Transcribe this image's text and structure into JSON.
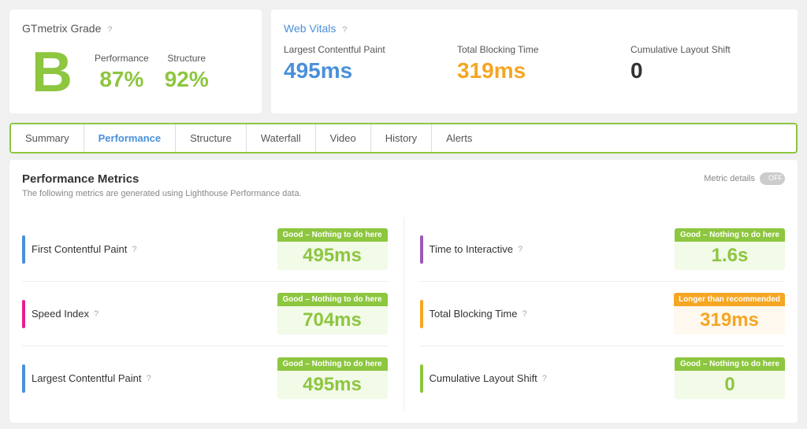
{
  "header": {
    "grade_section": "GTmetrix Grade",
    "grade_letter": "B",
    "performance_label": "Performance",
    "performance_value": "87%",
    "structure_label": "Structure",
    "structure_value": "92%",
    "vitals_section": "Web Vitals",
    "lcp_label": "Largest Contentful Paint",
    "lcp_value": "495ms",
    "tbt_label": "Total Blocking Time",
    "tbt_value": "319ms",
    "cls_label": "Cumulative Layout Shift",
    "cls_value": "0",
    "help": "?"
  },
  "tabs": [
    {
      "id": "summary",
      "label": "Summary",
      "active": false
    },
    {
      "id": "performance",
      "label": "Performance",
      "active": true
    },
    {
      "id": "structure",
      "label": "Structure",
      "active": false
    },
    {
      "id": "waterfall",
      "label": "Waterfall",
      "active": false
    },
    {
      "id": "video",
      "label": "Video",
      "active": false
    },
    {
      "id": "history",
      "label": "History",
      "active": false
    },
    {
      "id": "alerts",
      "label": "Alerts",
      "active": false
    }
  ],
  "performance": {
    "title": "Performance Metrics",
    "subtitle": "The following metrics are generated using Lighthouse Performance data.",
    "metric_details_label": "Metric details",
    "toggle_label": "OFF",
    "left_metrics": [
      {
        "bar_color": "bar-blue",
        "name": "First Contentful Paint",
        "status": "Good – Nothing to do here",
        "status_type": "good",
        "value": "495ms",
        "value_type": "good"
      },
      {
        "bar_color": "bar-pink",
        "name": "Speed Index",
        "status": "Good – Nothing to do here",
        "status_type": "good",
        "value": "704ms",
        "value_type": "good"
      },
      {
        "bar_color": "bar-blue",
        "name": "Largest Contentful Paint",
        "status": "Good – Nothing to do here",
        "status_type": "good",
        "value": "495ms",
        "value_type": "good"
      }
    ],
    "right_metrics": [
      {
        "bar_color": "bar-purple",
        "name": "Time to Interactive",
        "status": "Good – Nothing to do here",
        "status_type": "good",
        "value": "1.6s",
        "value_type": "good"
      },
      {
        "bar_color": "bar-orange",
        "name": "Total Blocking Time",
        "status": "Longer than recommended",
        "status_type": "warn",
        "value": "319ms",
        "value_type": "warn"
      },
      {
        "bar_color": "bar-green",
        "name": "Cumulative Layout Shift",
        "status": "Good – Nothing to do here",
        "status_type": "good",
        "value": "0",
        "value_type": "good"
      }
    ]
  }
}
